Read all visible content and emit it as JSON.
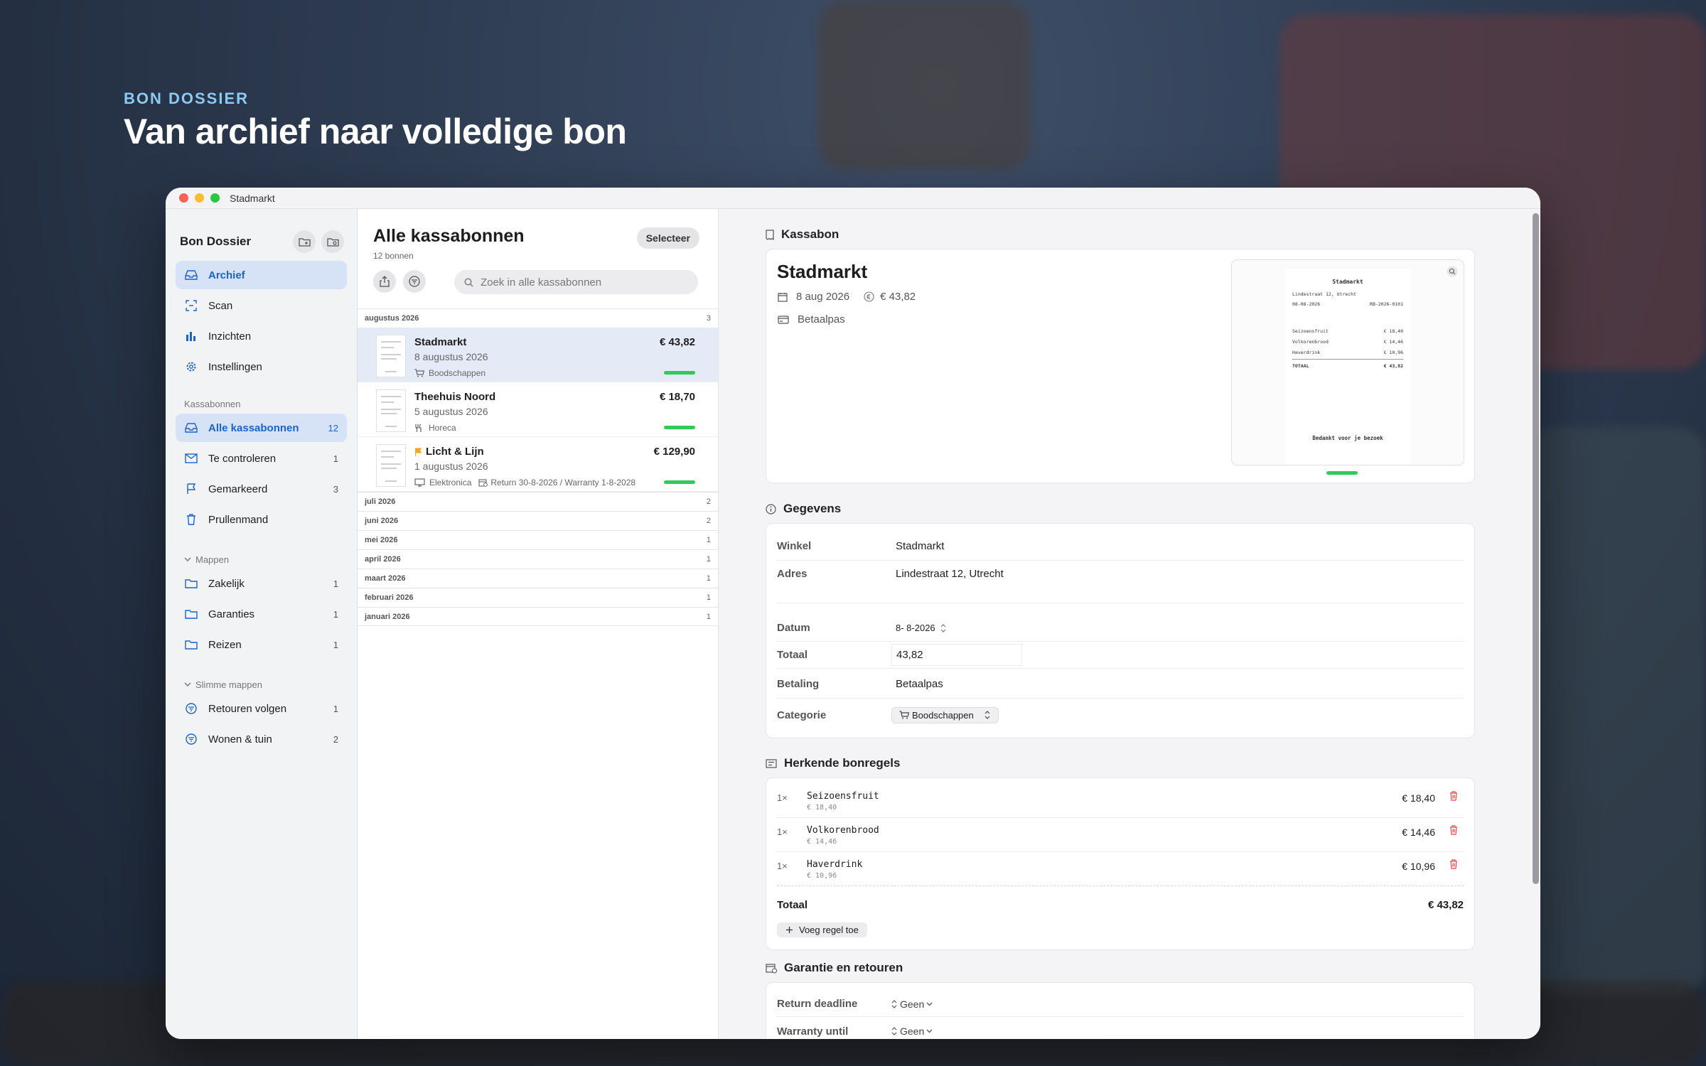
{
  "hero": {
    "kicker": "BON DOSSIER",
    "title": "Van archief naar volledige bon"
  },
  "window": {
    "title": "Stadmarkt"
  },
  "sidebar": {
    "title": "Bon Dossier",
    "top_items": [
      {
        "label": "Archief",
        "count": ""
      },
      {
        "label": "Scan",
        "count": ""
      },
      {
        "label": "Inzichten",
        "count": ""
      },
      {
        "label": "Instellingen",
        "count": ""
      }
    ],
    "section_receipts": "Kassabonnen",
    "receipt_items": [
      {
        "label": "Alle kassabonnen",
        "count": "12"
      },
      {
        "label": "Te controleren",
        "count": "1"
      },
      {
        "label": "Gemarkeerd",
        "count": "3"
      },
      {
        "label": "Prullenmand",
        "count": ""
      }
    ],
    "section_folders": "Mappen",
    "folders": [
      {
        "label": "Zakelijk",
        "count": "1"
      },
      {
        "label": "Garanties",
        "count": "1"
      },
      {
        "label": "Reizen",
        "count": "1"
      }
    ],
    "section_smart": "Slimme mappen",
    "smart": [
      {
        "label": "Retouren volgen",
        "count": "1"
      },
      {
        "label": "Wonen & tuin",
        "count": "2"
      }
    ]
  },
  "list": {
    "title": "Alle kassabonnen",
    "subtitle": "12 bonnen",
    "select_label": "Selecteer",
    "search_placeholder": "Zoek in alle kassabonnen",
    "current_group": {
      "label": "augustus 2026",
      "count": "3"
    },
    "rows": [
      {
        "name": "Stadmarkt",
        "date": "8 augustus 2026",
        "category": "Boodschappen",
        "price": "€ 43,82",
        "extra": ""
      },
      {
        "name": "Theehuis Noord",
        "date": "5 augustus 2026",
        "category": "Horeca",
        "price": "€ 18,70",
        "extra": ""
      },
      {
        "name": "Licht & Lijn",
        "date": "1 augustus 2026",
        "category": "Elektronica",
        "price": "€ 129,90",
        "extra": "Return 30-8-2026 / Warranty 1-8-2028"
      }
    ],
    "groups": [
      {
        "label": "juli 2026",
        "count": "2"
      },
      {
        "label": "juni 2026",
        "count": "2"
      },
      {
        "label": "mei 2026",
        "count": "1"
      },
      {
        "label": "april 2026",
        "count": "1"
      },
      {
        "label": "maart 2026",
        "count": "1"
      },
      {
        "label": "februari 2026",
        "count": "1"
      },
      {
        "label": "januari 2026",
        "count": "1"
      }
    ]
  },
  "detail": {
    "receipt": {
      "section": "Kassabon",
      "store": "Stadmarkt",
      "date": "8 aug 2026",
      "amount": "€ 43,82",
      "payment": "Betaalpas",
      "paper": {
        "store": "Stadmarkt",
        "address": "Lindestraat 12, Utrecht",
        "date": "08-08-2026",
        "ref": "RB-2026-0101",
        "lines": [
          {
            "name": "Seizoensfruit",
            "price": "€ 18,40"
          },
          {
            "name": "Volkorenbrood",
            "price": "€ 14,46"
          },
          {
            "name": "Haverdrink",
            "price": "€ 10,96"
          }
        ],
        "total_label": "TOTAAL",
        "total": "€ 43,82",
        "thanks": "Bedankt voor je bezoek"
      }
    },
    "details": {
      "section": "Gegevens",
      "store_label": "Winkel",
      "store": "Stadmarkt",
      "address_label": "Adres",
      "address": "Lindestraat 12, Utrecht",
      "date_label": "Datum",
      "date": "8- 8-2026",
      "total_label": "Totaal",
      "total": "43,82",
      "payment_label": "Betaling",
      "payment": "Betaalpas",
      "category_label": "Categorie",
      "category": "Boodschappen"
    },
    "lines": {
      "section": "Herkende bonregels",
      "items": [
        {
          "qty": "1×",
          "name": "Seizoensfruit",
          "sub": "€ 18,40",
          "price": "€ 18,40"
        },
        {
          "qty": "1×",
          "name": "Volkorenbrood",
          "sub": "€ 14,46",
          "price": "€ 14,46"
        },
        {
          "qty": "1×",
          "name": "Haverdrink",
          "sub": "€ 10,96",
          "price": "€ 10,96"
        }
      ],
      "total_label": "Totaal",
      "total": "€ 43,82",
      "add_label": "Voeg regel toe"
    },
    "warranty": {
      "section": "Garantie en retouren",
      "return_label": "Return deadline",
      "return_value": "Geen",
      "warranty_label": "Warranty until",
      "warranty_value": "Geen"
    }
  },
  "colors": {
    "accent": "#1d63c4",
    "success": "#34c759",
    "flag": "#f5a623",
    "danger": "#e5484d"
  }
}
